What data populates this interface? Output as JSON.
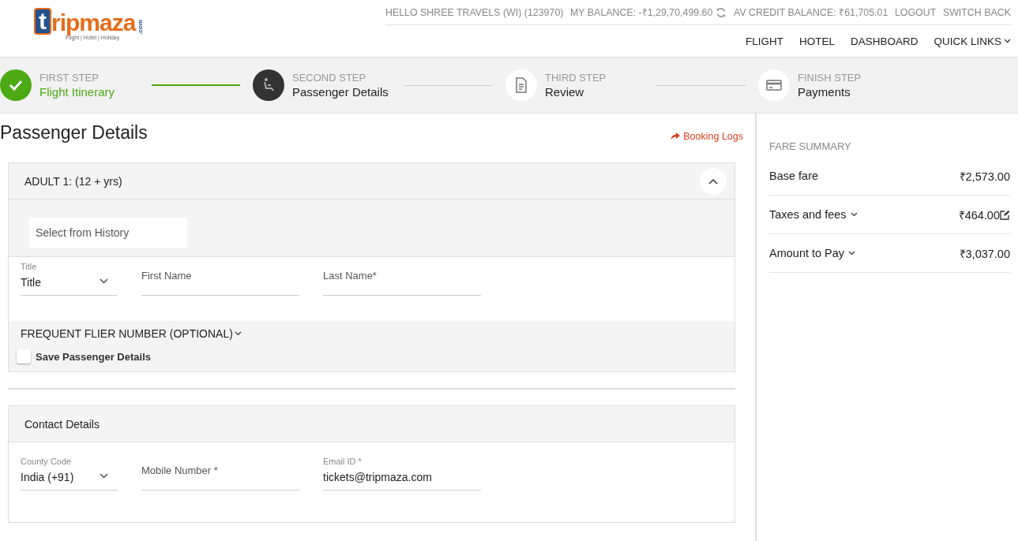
{
  "logo": {
    "letter": "t",
    "rest": "ripmaza",
    "tld": ".com",
    "tagline": "Flight | Hotel | Holiday"
  },
  "top_bar": {
    "greeting": "HELLO SHREE TRAVELS (WI) (123970)",
    "balance": "MY BALANCE: -₹1,29,70,499.60",
    "credit": "AV CREDIT BALANCE: ₹61,705.01",
    "links": [
      "LOGOUT",
      "SWITCH BACK"
    ]
  },
  "nav": [
    {
      "label": "FLIGHT",
      "dropdown": false
    },
    {
      "label": "HOTEL",
      "dropdown": false
    },
    {
      "label": "DASHBOARD",
      "dropdown": false
    },
    {
      "label": "QUICK LINKS",
      "dropdown": true
    }
  ],
  "steps": [
    {
      "kind": "done",
      "caption": "FIRST STEP",
      "title": "Flight Itinerary"
    },
    {
      "kind": "current",
      "caption": "SECOND STEP",
      "title": "Passenger Details"
    },
    {
      "kind": "review",
      "caption": "THIRD STEP",
      "title": "Review"
    },
    {
      "kind": "payment",
      "caption": "FINISH STEP",
      "title": "Payments"
    }
  ],
  "page_title": "Passenger Details",
  "booking_logs": "Booking Logs",
  "passenger": {
    "heading": "ADULT 1: (12 + yrs)",
    "expanded": true,
    "history_placeholder": "Select from History",
    "fields": [
      {
        "kind": "select",
        "label": "Title",
        "value": "Title"
      },
      {
        "kind": "text",
        "placeholder": "First Name"
      },
      {
        "kind": "text",
        "placeholder": "Last Name*"
      }
    ],
    "frequent_flier": "FREQUENT FLIER NUMBER (OPTIONAL)",
    "save_label": "Save Passenger Details",
    "save_checked": false
  },
  "contact": {
    "heading": "Contact Details",
    "fields": [
      {
        "kind": "select",
        "label": "County Code",
        "value": "India (+91)"
      },
      {
        "kind": "text",
        "placeholder": "Mobile Number *"
      },
      {
        "kind": "text",
        "label": "Email ID *",
        "value": "tickets@tripmaza.com"
      }
    ]
  },
  "fare_summary": {
    "title": "FARE SUMMARY",
    "rows": [
      {
        "label": "Base fare",
        "amount": "₹2,573.00",
        "dropdown": false,
        "editable": false
      },
      {
        "label": "Taxes and fees",
        "amount": "₹464.00",
        "dropdown": true,
        "editable": true
      },
      {
        "label": "Amount to Pay",
        "amount": "₹3,037.00",
        "dropdown": true,
        "editable": false
      }
    ]
  }
}
